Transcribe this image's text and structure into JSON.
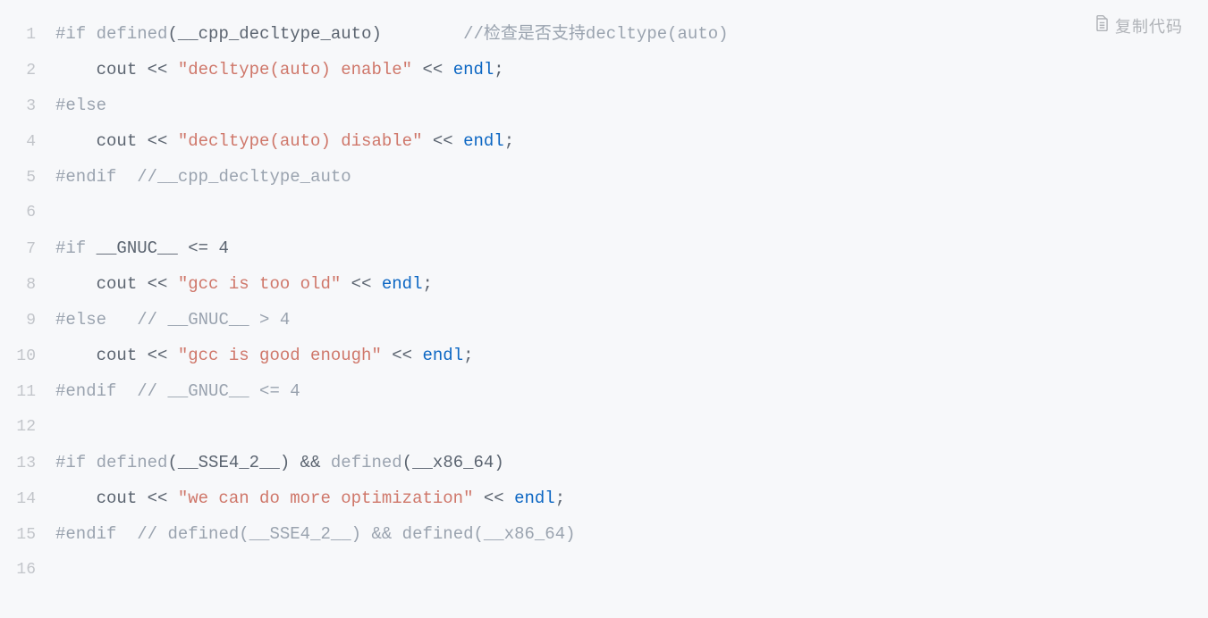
{
  "copy_label": "复制代码",
  "lines": [
    {
      "n": "1",
      "tokens": [
        {
          "c": "c-pre",
          "t": "#if"
        },
        {
          "c": "c-plain",
          "t": " "
        },
        {
          "c": "c-pre",
          "t": "defined"
        },
        {
          "c": "c-plain",
          "t": "(__cpp_decltype_auto)        "
        },
        {
          "c": "c-comment",
          "t": "//检查是否支持decltype(auto)"
        }
      ]
    },
    {
      "n": "2",
      "tokens": [
        {
          "c": "c-plain",
          "t": "    cout << "
        },
        {
          "c": "c-string",
          "t": "\"decltype(auto) enable\""
        },
        {
          "c": "c-plain",
          "t": " << "
        },
        {
          "c": "c-kw",
          "t": "endl"
        },
        {
          "c": "c-plain",
          "t": ";"
        }
      ]
    },
    {
      "n": "3",
      "tokens": [
        {
          "c": "c-pre",
          "t": "#else"
        }
      ]
    },
    {
      "n": "4",
      "tokens": [
        {
          "c": "c-plain",
          "t": "    cout << "
        },
        {
          "c": "c-string",
          "t": "\"decltype(auto) disable\""
        },
        {
          "c": "c-plain",
          "t": " << "
        },
        {
          "c": "c-kw",
          "t": "endl"
        },
        {
          "c": "c-plain",
          "t": ";"
        }
      ]
    },
    {
      "n": "5",
      "tokens": [
        {
          "c": "c-pre",
          "t": "#endif"
        },
        {
          "c": "c-plain",
          "t": "  "
        },
        {
          "c": "c-comment",
          "t": "//__cpp_decltype_auto"
        }
      ]
    },
    {
      "n": "6",
      "tokens": []
    },
    {
      "n": "7",
      "tokens": [
        {
          "c": "c-pre",
          "t": "#if"
        },
        {
          "c": "c-plain",
          "t": " __GNUC__ <= "
        },
        {
          "c": "c-num",
          "t": "4"
        }
      ]
    },
    {
      "n": "8",
      "tokens": [
        {
          "c": "c-plain",
          "t": "    cout << "
        },
        {
          "c": "c-string",
          "t": "\"gcc is too old\""
        },
        {
          "c": "c-plain",
          "t": " << "
        },
        {
          "c": "c-kw",
          "t": "endl"
        },
        {
          "c": "c-plain",
          "t": ";"
        }
      ]
    },
    {
      "n": "9",
      "tokens": [
        {
          "c": "c-pre",
          "t": "#else"
        },
        {
          "c": "c-plain",
          "t": "   "
        },
        {
          "c": "c-comment",
          "t": "// __GNUC__ > 4"
        }
      ]
    },
    {
      "n": "10",
      "tokens": [
        {
          "c": "c-plain",
          "t": "    cout << "
        },
        {
          "c": "c-string",
          "t": "\"gcc is good enough\""
        },
        {
          "c": "c-plain",
          "t": " << "
        },
        {
          "c": "c-kw",
          "t": "endl"
        },
        {
          "c": "c-plain",
          "t": ";"
        }
      ]
    },
    {
      "n": "11",
      "tokens": [
        {
          "c": "c-pre",
          "t": "#endif"
        },
        {
          "c": "c-plain",
          "t": "  "
        },
        {
          "c": "c-comment",
          "t": "// __GNUC__ <= 4"
        }
      ]
    },
    {
      "n": "12",
      "tokens": []
    },
    {
      "n": "13",
      "tokens": [
        {
          "c": "c-pre",
          "t": "#if"
        },
        {
          "c": "c-plain",
          "t": " "
        },
        {
          "c": "c-pre",
          "t": "defined"
        },
        {
          "c": "c-plain",
          "t": "(__SSE4_2__) && "
        },
        {
          "c": "c-pre",
          "t": "defined"
        },
        {
          "c": "c-plain",
          "t": "(__x86_64)"
        }
      ]
    },
    {
      "n": "14",
      "tokens": [
        {
          "c": "c-plain",
          "t": "    cout << "
        },
        {
          "c": "c-string",
          "t": "\"we can do more optimization\""
        },
        {
          "c": "c-plain",
          "t": " << "
        },
        {
          "c": "c-kw",
          "t": "endl"
        },
        {
          "c": "c-plain",
          "t": ";"
        }
      ]
    },
    {
      "n": "15",
      "tokens": [
        {
          "c": "c-pre",
          "t": "#endif"
        },
        {
          "c": "c-plain",
          "t": "  "
        },
        {
          "c": "c-comment",
          "t": "// defined(__SSE4_2__) && defined(__x86_64)"
        }
      ]
    },
    {
      "n": "16",
      "tokens": []
    }
  ]
}
